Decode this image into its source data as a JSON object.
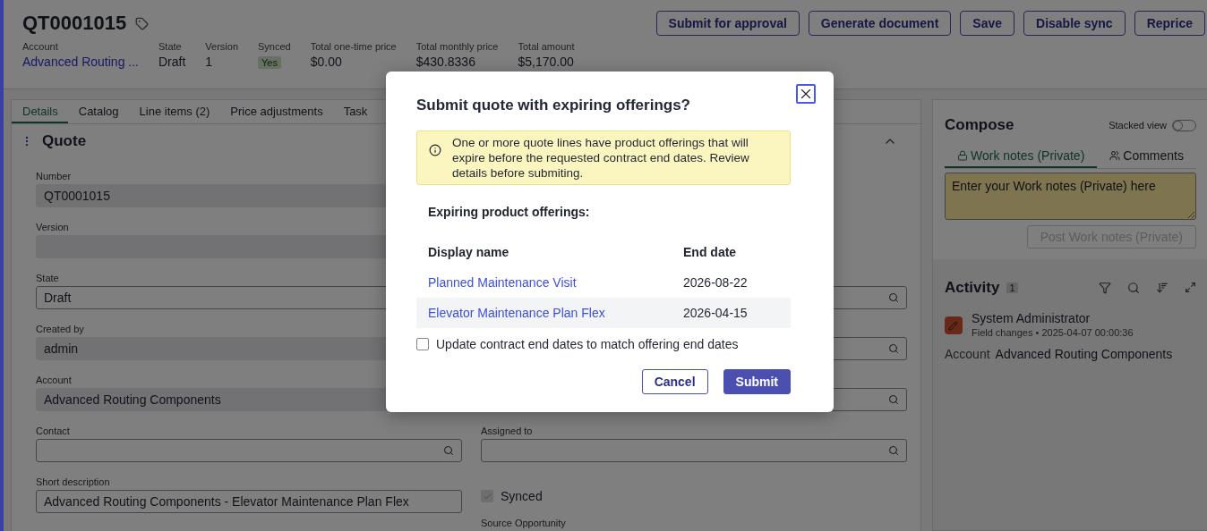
{
  "record": {
    "title": "QT0001015"
  },
  "header_fields": [
    {
      "label": "Account",
      "value": "Advanced Routing ...",
      "kind": "link"
    },
    {
      "label": "State",
      "value": "Draft",
      "kind": "text"
    },
    {
      "label": "Version",
      "value": "1",
      "kind": "text"
    },
    {
      "label": "Synced",
      "value": "Yes",
      "kind": "badge"
    },
    {
      "label": "Total one-time price",
      "value": "$0.00",
      "kind": "text"
    },
    {
      "label": "Total monthly price",
      "value": "$430.8336",
      "kind": "text"
    },
    {
      "label": "Total amount",
      "value": "$5,170.00",
      "kind": "text"
    }
  ],
  "actions": [
    "Submit for approval",
    "Generate document",
    "Save",
    "Disable sync",
    "Reprice"
  ],
  "tabs": [
    {
      "label": "Details",
      "selected": true
    },
    {
      "label": "Catalog",
      "selected": false
    },
    {
      "label": "Line items (2)",
      "selected": false
    },
    {
      "label": "Price adjustments",
      "selected": false
    },
    {
      "label": "Task",
      "selected": false
    }
  ],
  "section": {
    "title": "Quote",
    "expanded": true
  },
  "left_fields": [
    {
      "label": "Number",
      "value": "QT0001015",
      "kind": "readonly"
    },
    {
      "label": "Version",
      "kind": "readonly"
    },
    {
      "label": "State",
      "value": "Draft",
      "kind": "select"
    },
    {
      "label": "Created by",
      "value": "admin",
      "kind": "readonly"
    },
    {
      "label": "Account",
      "value": "Advanced Routing Components",
      "kind": "readonly"
    },
    {
      "label": "Contact",
      "kind": "lookup"
    },
    {
      "label": "Short description",
      "value": "Advanced Routing Components - Elevator Maintenance Plan Flex",
      "kind": "input"
    }
  ],
  "right_fields": [
    {
      "kind": "lookup"
    },
    {
      "kind": "lookup"
    },
    {
      "kind": "lookup"
    },
    {
      "label": "Assigned to",
      "kind": "lookup"
    },
    {
      "label": "Synced",
      "kind": "checkbox",
      "checked": true
    },
    {
      "label": "Source Opportunity",
      "kind": "label"
    }
  ],
  "compose": {
    "title": "Compose",
    "stacked_view": {
      "label": "Stacked view",
      "on": false
    },
    "tabs": [
      {
        "label": "Work notes (Private)",
        "kind": "private",
        "selected": true
      },
      {
        "label": "Comments",
        "kind": "public",
        "selected": false
      }
    ],
    "placeholder": "Enter your Work notes (Private) here",
    "post_button": {
      "label": "Post Work notes (Private)",
      "disabled": true
    }
  },
  "activity": {
    "title": "Activity",
    "count": "1",
    "entries": [
      {
        "author": "System Administrator",
        "meta": "Field changes • 2025-04-07 00:00:36",
        "changes": [
          {
            "field": "Account",
            "value": "Advanced Routing Components"
          }
        ]
      }
    ]
  },
  "dialog": {
    "title": "Submit quote with expiring offerings?",
    "alert": "One or more quote lines have product offerings that will expire before the requested contract end dates. Review details before submiting.",
    "subtitle": "Expiring product offerings:",
    "columns": [
      "Display name",
      "End date"
    ],
    "rows": [
      {
        "name": "Planned Maintenance Visit",
        "end_date": "2026-08-22"
      },
      {
        "name": "Elevator Maintenance Plan Flex",
        "end_date": "2026-04-15"
      }
    ],
    "checkbox": {
      "label": "Update contract end dates to match offering end dates",
      "checked": false
    },
    "buttons": [
      {
        "label": "Cancel",
        "kind": "secondary"
      },
      {
        "label": "Submit",
        "kind": "primary"
      }
    ]
  }
}
